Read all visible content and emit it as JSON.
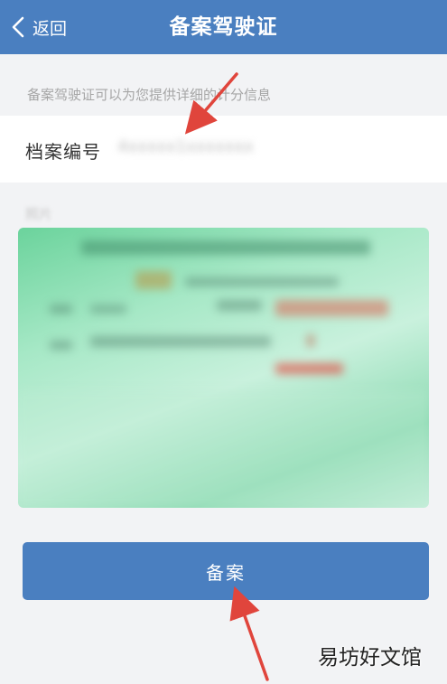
{
  "header": {
    "back_label": "返回",
    "title": "备案驾驶证"
  },
  "form": {
    "hint": "备案驾驶证可以为您提供详细的计分信息",
    "archive_label": "档案编号",
    "archive_value": "4xxxxx1xxxxxxx",
    "photo_label": "照片"
  },
  "submit": {
    "label": "备案"
  },
  "watermark": "易坊好文馆",
  "colors": {
    "header": "#4a7fc0",
    "button": "#4a7fc0",
    "arrow": "#e0453c",
    "license_green": "#8fdbb4"
  },
  "icons": {
    "back": "chevron-left-icon"
  }
}
